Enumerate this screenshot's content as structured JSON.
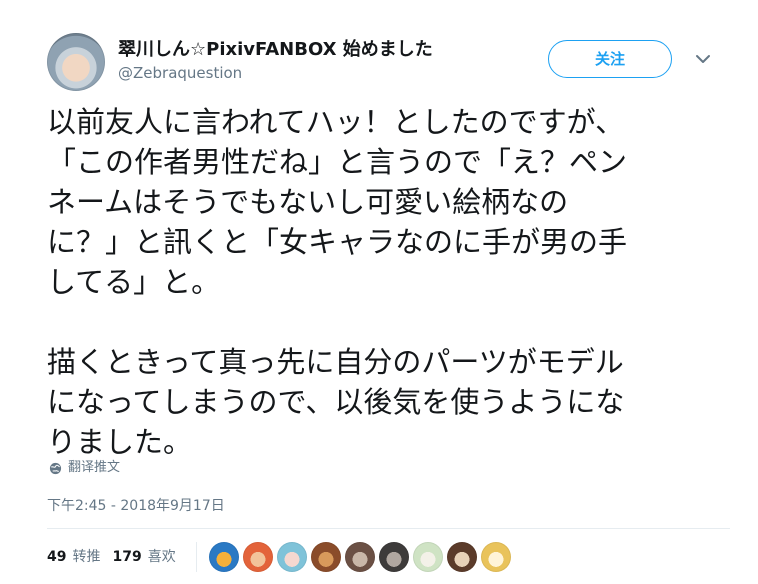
{
  "user": {
    "display_name": "翠川しん☆PixivFANBOX 始めました",
    "screen_name": "@Zebraquestion"
  },
  "follow_label": "关注",
  "tweet": {
    "text": "以前友人に言われてハッ！としたのですが、\n「この作者男性だね」と言うので「え？ペン\nネームはそうでもないし可愛い絵柄なの\nに？」と訊くと「女キャラなのに手が男の手\nしてる」と。\n\n描くときって真っ先に自分のパーツがモデル\nになってしまうので、以後気を使うようにな\nりました。"
  },
  "translate_label": "翻译推文",
  "timestamp": "下午2:45 - 2018年9月17日",
  "stats": {
    "retweets_count": "49",
    "retweets_label": "转推",
    "likes_count": "179",
    "likes_label": "喜欢"
  },
  "colors": {
    "accent": "#1da1f2",
    "text": "#14171a",
    "secondary_text": "#657786",
    "divider": "#e6ecf0"
  },
  "icons": {
    "caret": "chevron-down-icon",
    "translate": "globe-icon"
  },
  "liker_avatars": [
    {
      "colors": [
        "#2a79c4",
        "#f5b03a"
      ]
    },
    {
      "colors": [
        "#e3633a",
        "#f2c39a"
      ]
    },
    {
      "colors": [
        "#7fc3d9",
        "#f5d8d0"
      ]
    },
    {
      "colors": [
        "#8a4c2a",
        "#d89a5b"
      ]
    },
    {
      "colors": [
        "#6b5044",
        "#c9b7a8"
      ]
    },
    {
      "colors": [
        "#3d3b3a",
        "#b0a7a0"
      ]
    },
    {
      "colors": [
        "#cfe3c4",
        "#f3f1e8"
      ]
    },
    {
      "colors": [
        "#5b3b2a",
        "#e8d2b8"
      ]
    },
    {
      "colors": [
        "#e9c35b",
        "#fff4d8"
      ]
    }
  ]
}
